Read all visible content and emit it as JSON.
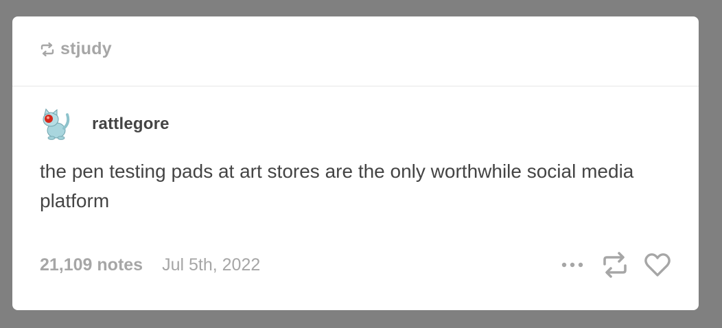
{
  "header": {
    "reblogger": "stjudy",
    "reblog_icon": "reblog-icon"
  },
  "post": {
    "author": "rattlegore",
    "avatar_icon": "cat-avatar",
    "text": "the pen testing pads at art stores are the only worthwhile social media platform"
  },
  "footer": {
    "notes": "21,109 notes",
    "date": "Jul 5th, 2022",
    "actions": [
      "more-options-icon",
      "reblog-icon",
      "heart-icon"
    ]
  },
  "colors": {
    "background": "#808080",
    "card": "#ffffff",
    "muted_text": "#a6a6a6",
    "body_text": "#444444",
    "divider": "#e6e6e6"
  }
}
